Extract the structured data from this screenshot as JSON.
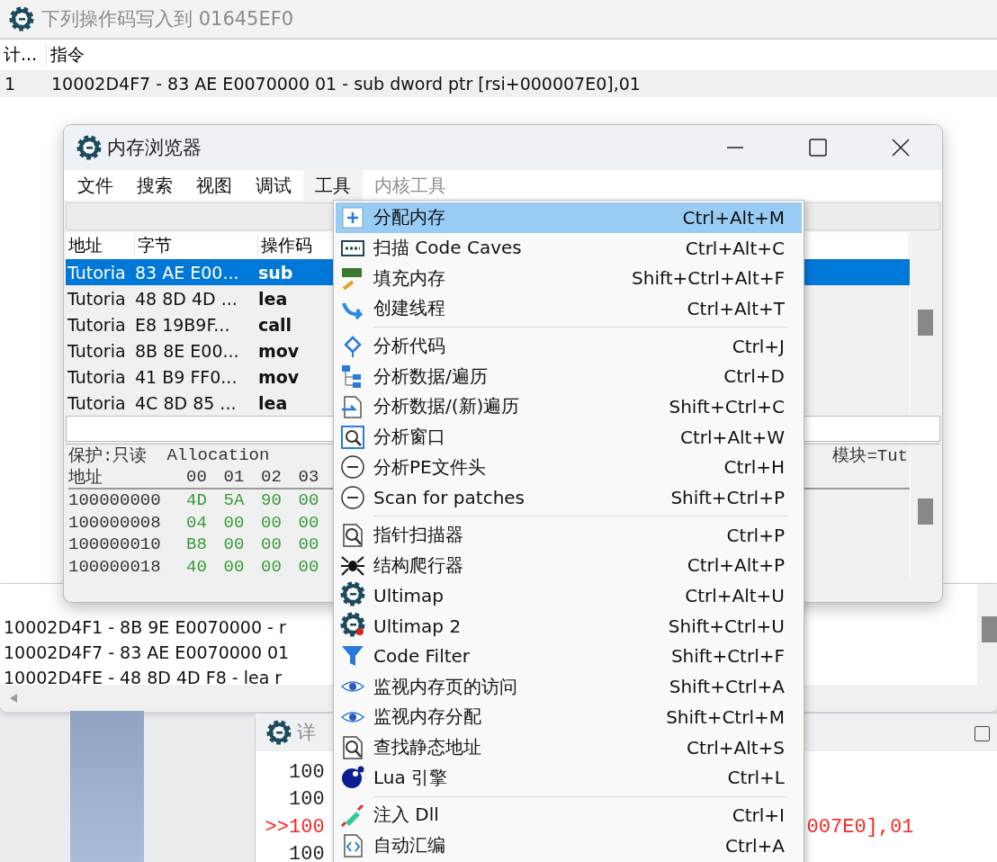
{
  "back_window": {
    "title": "下列操作码写入到 01645EF0",
    "columns": [
      "计...",
      "指令"
    ],
    "rows": [
      {
        "count": "1",
        "instruction": "10002D4F7 - 83 AE E0070000 01 - sub dword ptr [rsi+000007E0],01"
      }
    ]
  },
  "disasm_panel": {
    "lines": [
      "10002D4F1 - 8B 9E E0070000  - r",
      "10002D4F7 - 83 AE E0070000 01",
      "10002D4FE - 48 8D 4D F8  - lea r"
    ]
  },
  "detail_window": {
    "title": "详",
    "lines": [
      {
        "text": "100",
        "current": false
      },
      {
        "text": "100",
        "current": false
      },
      {
        "marker": ">>",
        "text": "100",
        "tail": "007E0],01",
        "current": true
      },
      {
        "text": "100",
        "current": false
      }
    ]
  },
  "memory_viewer": {
    "title": "内存浏览器",
    "menus": [
      {
        "label": "文件",
        "selected": false,
        "disabled": false
      },
      {
        "label": "搜索",
        "selected": false,
        "disabled": false
      },
      {
        "label": "视图",
        "selected": false,
        "disabled": false
      },
      {
        "label": "调试",
        "selected": false,
        "disabled": false
      },
      {
        "label": "工具",
        "selected": true,
        "disabled": false
      },
      {
        "label": "内核工具",
        "selected": false,
        "disabled": true
      }
    ],
    "disasm": {
      "columns": [
        "地址",
        "字节",
        "操作码"
      ],
      "rows": [
        {
          "address": "Tutoria",
          "bytes": "83 AE E00...",
          "opcode": "sub",
          "selected": true
        },
        {
          "address": "Tutoria",
          "bytes": "48 8D 4D ...",
          "opcode": "lea",
          "selected": false
        },
        {
          "address": "Tutoria",
          "bytes": "E8 19B9F...",
          "opcode": "call",
          "selected": false
        },
        {
          "address": "Tutoria",
          "bytes": "8B 8E E00...",
          "opcode": "mov",
          "selected": false
        },
        {
          "address": "Tutoria",
          "bytes": "41 B9 FF0...",
          "opcode": "mov",
          "selected": false
        },
        {
          "address": "Tutoria",
          "bytes": "4C 8D 85 ...",
          "opcode": "lea",
          "selected": false
        }
      ]
    },
    "hex": {
      "protection": "保护:只读",
      "allocation": "Allocation",
      "module": "模块=Tut",
      "columns": [
        "地址",
        "00",
        "01",
        "02",
        "03"
      ],
      "rows": [
        {
          "address": "100000000",
          "bytes": [
            "4D",
            "5A",
            "90",
            "00"
          ]
        },
        {
          "address": "100000008",
          "bytes": [
            "04",
            "00",
            "00",
            "00"
          ]
        },
        {
          "address": "100000010",
          "bytes": [
            "B8",
            "00",
            "00",
            "00"
          ]
        },
        {
          "address": "100000018",
          "bytes": [
            "40",
            "00",
            "00",
            "00"
          ]
        }
      ]
    }
  },
  "tools_menu": {
    "items": [
      {
        "kind": "item",
        "label": "分配内存",
        "shortcut": "Ctrl+Alt+M",
        "selected": true
      },
      {
        "kind": "item",
        "label": "扫描 Code Caves",
        "shortcut": "Ctrl+Alt+C",
        "selected": false
      },
      {
        "kind": "item",
        "label": "填充内存",
        "shortcut": "Shift+Ctrl+Alt+F",
        "selected": false
      },
      {
        "kind": "item",
        "label": "创建线程",
        "shortcut": "Ctrl+Alt+T",
        "selected": false
      },
      {
        "kind": "separator"
      },
      {
        "kind": "item",
        "label": "分析代码",
        "shortcut": "Ctrl+J",
        "selected": false
      },
      {
        "kind": "item",
        "label": "分析数据/遍历",
        "shortcut": "Ctrl+D",
        "selected": false
      },
      {
        "kind": "item",
        "label": "分析数据/(新)遍历",
        "shortcut": "Shift+Ctrl+C",
        "selected": false
      },
      {
        "kind": "item",
        "label": "分析窗口",
        "shortcut": "Ctrl+Alt+W",
        "selected": false
      },
      {
        "kind": "item",
        "label": "分析PE文件头",
        "shortcut": "Ctrl+H",
        "selected": false
      },
      {
        "kind": "item",
        "label": "Scan for patches",
        "shortcut": "Shift+Ctrl+P",
        "selected": false
      },
      {
        "kind": "separator"
      },
      {
        "kind": "item",
        "label": "指针扫描器",
        "shortcut": "Ctrl+P",
        "selected": false
      },
      {
        "kind": "item",
        "label": "结构爬行器",
        "shortcut": "Ctrl+Alt+P",
        "selected": false
      },
      {
        "kind": "item",
        "label": "Ultimap",
        "shortcut": "Ctrl+Alt+U",
        "selected": false
      },
      {
        "kind": "item",
        "label": "Ultimap 2",
        "shortcut": "Shift+Ctrl+U",
        "selected": false
      },
      {
        "kind": "item",
        "label": "Code Filter",
        "shortcut": "Shift+Ctrl+F",
        "selected": false
      },
      {
        "kind": "item",
        "label": "监视内存页的访问",
        "shortcut": "Shift+Ctrl+A",
        "selected": false
      },
      {
        "kind": "item",
        "label": "监视内存分配",
        "shortcut": "Shift+Ctrl+M",
        "selected": false
      },
      {
        "kind": "item",
        "label": "查找静态地址",
        "shortcut": "Ctrl+Alt+S",
        "selected": false
      },
      {
        "kind": "item",
        "label": "Lua 引擎",
        "shortcut": "Ctrl+L",
        "selected": false
      },
      {
        "kind": "separator"
      },
      {
        "kind": "item",
        "label": "注入 Dll",
        "shortcut": "Ctrl+I",
        "selected": false
      },
      {
        "kind": "item",
        "label": "自动汇编",
        "shortcut": "Ctrl+A",
        "selected": false
      }
    ]
  }
}
